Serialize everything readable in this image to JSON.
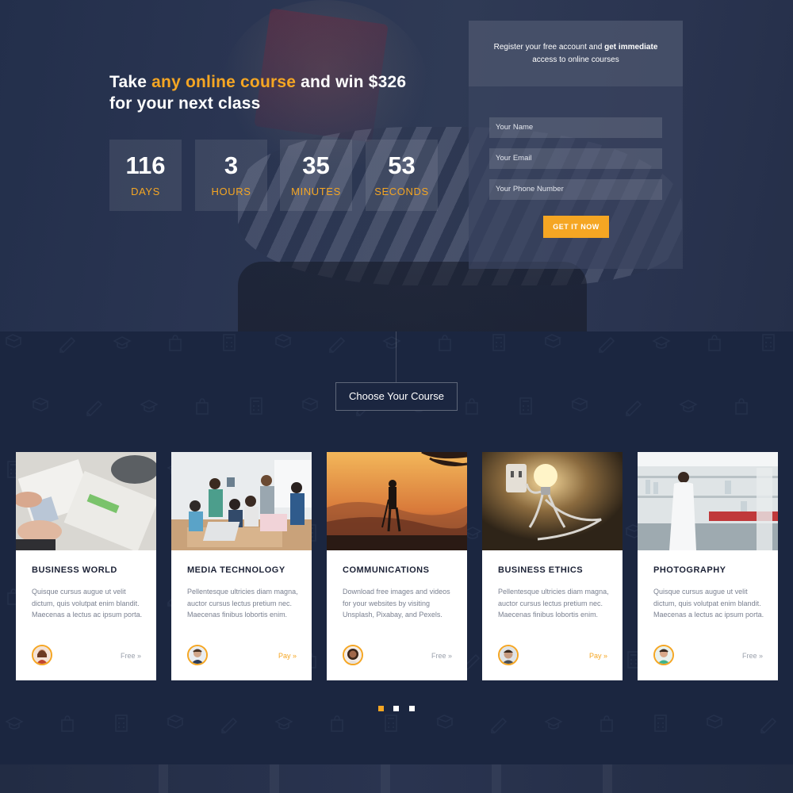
{
  "hero": {
    "title_pre": "Take ",
    "title_highlight": "any online course",
    "title_post": " and win $326",
    "title_line2": "for your next class",
    "countdown": [
      {
        "value": "116",
        "unit": "DAYS"
      },
      {
        "value": "3",
        "unit": "HOURS"
      },
      {
        "value": "35",
        "unit": "MINUTES"
      },
      {
        "value": "53",
        "unit": "SECONDS"
      }
    ]
  },
  "form": {
    "intro_pre": "Register your free account and ",
    "intro_bold": "get immediate",
    "intro_line2": "access to online courses",
    "name_placeholder": "Your Name",
    "email_placeholder": "Your Email",
    "phone_placeholder": "Your Phone Number",
    "submit_label": "GET IT NOW"
  },
  "section": {
    "choose_label": "Choose Your Course"
  },
  "courses": [
    {
      "title": "BUSINESS WORLD",
      "desc": "Quisque cursus augue ut velit dictum, quis volutpat enim blandit. Maecenas a lectus ac ipsum porta.",
      "price": "Free »",
      "price_type": "free"
    },
    {
      "title": "MEDIA TECHNOLOGY",
      "desc": "Pellentesque ultricies diam magna, auctor cursus lectus pretium nec. Maecenas finibus lobortis enim.",
      "price": "Pay »",
      "price_type": "pay"
    },
    {
      "title": "COMMUNICATIONS",
      "desc": "Download free images and videos for your websites by visiting Unsplash, Pixabay, and Pexels.",
      "price": "Free »",
      "price_type": "free"
    },
    {
      "title": "BUSINESS ETHICS",
      "desc": "Pellentesque ultricies diam magna, auctor cursus lectus pretium nec. Maecenas finibus lobortis enim.",
      "price": "Pay »",
      "price_type": "pay"
    },
    {
      "title": "PHOTOGRAPHY",
      "desc": "Quisque cursus augue ut velit dictum, quis volutpat enim blandit. Maecenas a lectus ac ipsum porta.",
      "price": "Free »",
      "price_type": "free"
    }
  ],
  "carousel": {
    "active_index": 0,
    "count": 3
  },
  "colors": {
    "accent": "#f5a623",
    "navy": "#1b2640",
    "card_title": "#1c2236"
  }
}
